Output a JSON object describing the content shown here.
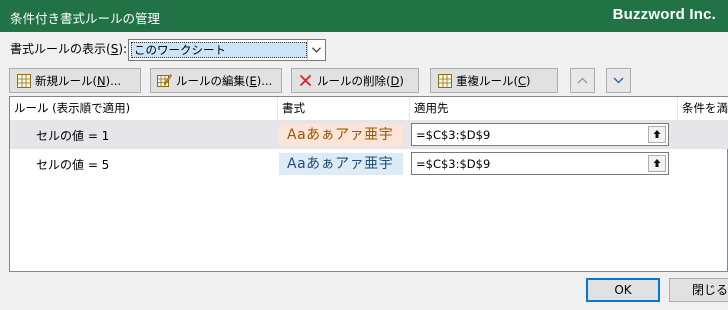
{
  "window": {
    "title": "条件付き書式ルールの管理",
    "brand": "Buzzword Inc."
  },
  "show_rules": {
    "label_prefix": "書式ルールの表示(",
    "label_key": "S",
    "label_suffix": "):",
    "value": "このワークシート"
  },
  "toolbar": {
    "new_rule": {
      "text": "新規ルール(",
      "key": "N",
      "after": ")..."
    },
    "edit_rule": {
      "text": "ルールの編集(",
      "key": "E",
      "after": ")..."
    },
    "delete_rule": {
      "text": "ルールの削除(",
      "key": "D",
      "after": ")"
    },
    "duplicate_rule": {
      "text": "重複ルール(",
      "key": "C",
      "after": ")"
    }
  },
  "grid": {
    "columns": [
      "ルール (表示順で適用)",
      "書式",
      "適用先",
      "条件を満"
    ],
    "rows": [
      {
        "rule": "セルの値 = 1",
        "format_sample": "Aaあぁアァ亜宇",
        "applies_to": "=$C$3:$D$9",
        "selected": true
      },
      {
        "rule": "セルの値 = 5",
        "format_sample": "Aaあぁアァ亜宇",
        "applies_to": "=$C$3:$D$9",
        "selected": false
      }
    ]
  },
  "buttons": {
    "ok": "OK",
    "close": "閉じる"
  },
  "colors": {
    "titlebar": "#217346",
    "format1_bg": "#fce4d6",
    "format1_fg": "#9c5700",
    "format2_bg": "#ddebf7",
    "format2_fg": "#1f4e78"
  }
}
